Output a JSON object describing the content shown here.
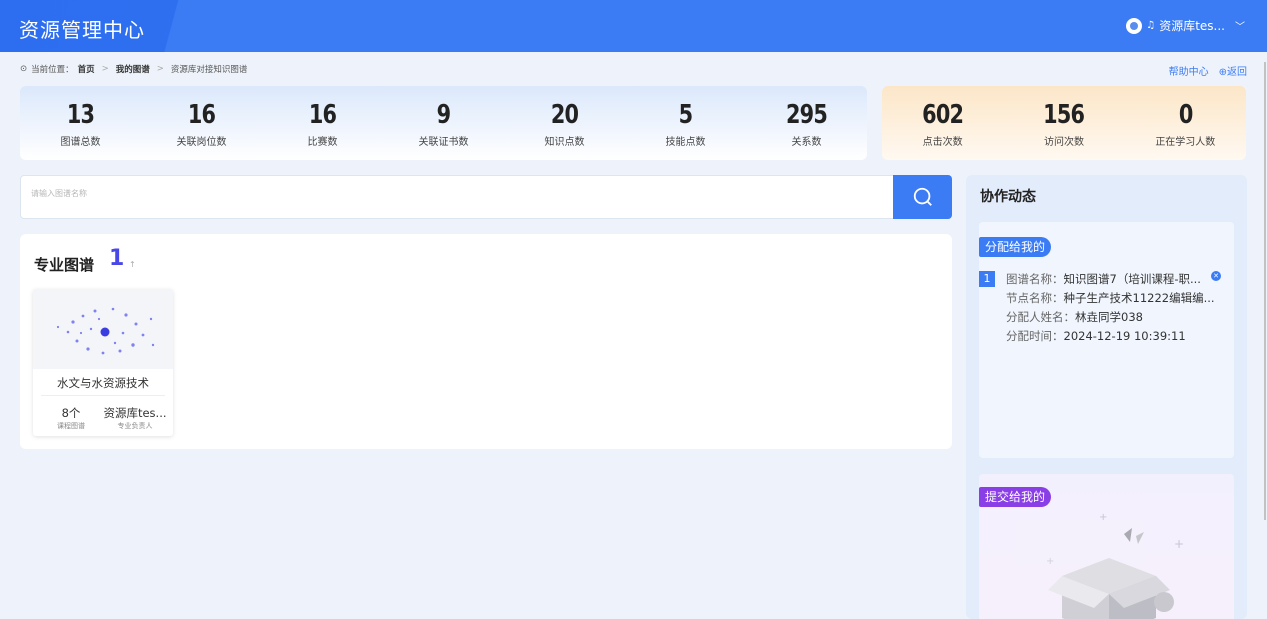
{
  "header": {
    "app_title": "资源管理中心",
    "user_name": "资源库tes...",
    "icon": "user-avatar-icon"
  },
  "breadcrumb": {
    "prefix": "当前位置：",
    "items": [
      "首页",
      "我的图谱",
      "资源库对接知识图谱"
    ]
  },
  "toplinks": {
    "help": "帮助中心",
    "back": "返回"
  },
  "stats_main": [
    {
      "value": "13",
      "label": "图谱总数"
    },
    {
      "value": "16",
      "label": "关联岗位数"
    },
    {
      "value": "16",
      "label": "比赛数"
    },
    {
      "value": "9",
      "label": "关联证书数"
    },
    {
      "value": "20",
      "label": "知识点数"
    },
    {
      "value": "5",
      "label": "技能点数"
    },
    {
      "value": "295",
      "label": "关系数"
    }
  ],
  "stats_side": [
    {
      "value": "602",
      "label": "点击次数"
    },
    {
      "value": "156",
      "label": "访问次数"
    },
    {
      "value": "0",
      "label": "正在学习人数"
    }
  ],
  "search": {
    "placeholder": "请输入图谱名称",
    "value": ""
  },
  "major_panel": {
    "title": "专业图谱",
    "count": "1",
    "sort_arrow": "↑",
    "cards": [
      {
        "name": "水文与水资源技术",
        "count_value": "8个",
        "count_label": "课程图谱",
        "owner_value": "资源库tes...",
        "owner_label": "专业负责人"
      }
    ]
  },
  "side": {
    "title": "协作动态",
    "assigned": {
      "tag": "分配给我的",
      "items": [
        {
          "index": "1",
          "rows": [
            {
              "key": "图谱名称：",
              "value": "知识图谱7（培训课程-职..."
            },
            {
              "key": "节点名称：",
              "value": "种子生产技术11222编辑编..."
            },
            {
              "key": "分配人姓名：",
              "value": "林垚同学038"
            },
            {
              "key": "分配时间：",
              "value": "2024-12-19 10:39:11"
            }
          ]
        }
      ]
    },
    "submitted": {
      "tag": "提交给我的"
    }
  },
  "colors": {
    "primary": "#3b7cf5",
    "accent_purple": "#8a3fe6",
    "count_purple": "#4a47e8",
    "header_bg": "#3b7cf5"
  }
}
